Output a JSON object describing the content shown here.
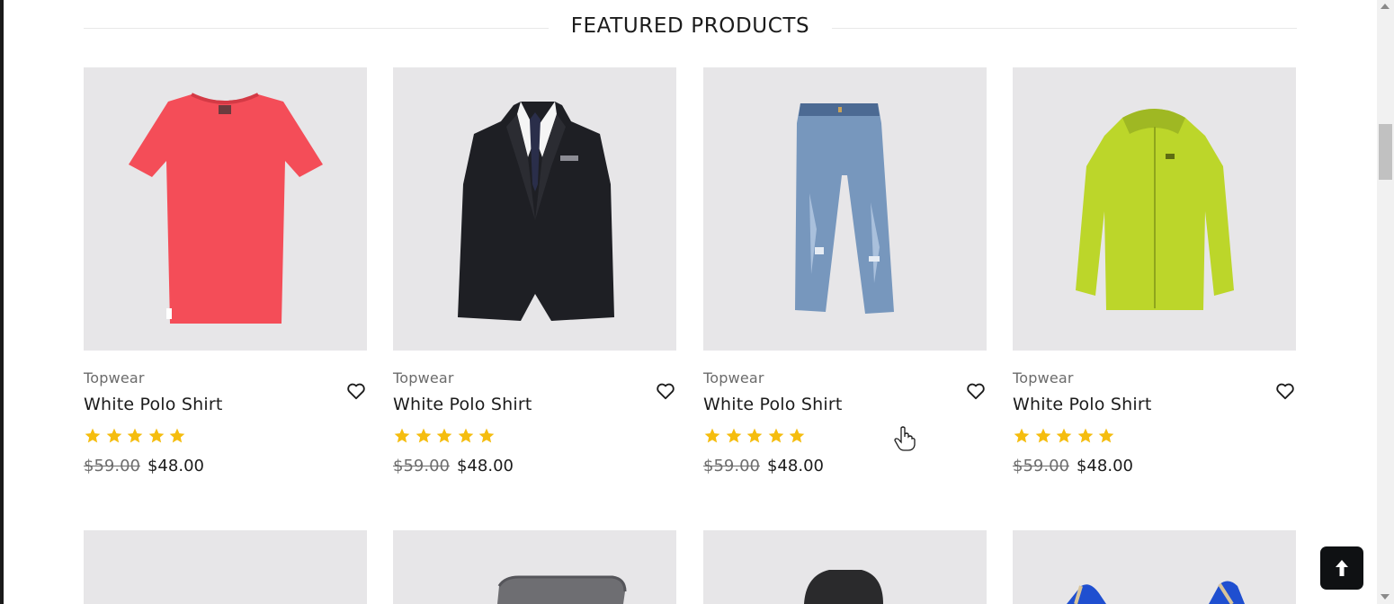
{
  "section": {
    "title": "FEATURED PRODUCTS"
  },
  "products": [
    {
      "category": "Topwear",
      "title": "White Polo Shirt",
      "rating": 5,
      "old_price": "$59.00",
      "new_price": "$48.00",
      "image_icon": "red-tshirt-icon"
    },
    {
      "category": "Topwear",
      "title": "White Polo Shirt",
      "rating": 5,
      "old_price": "$59.00",
      "new_price": "$48.00",
      "image_icon": "black-suit-jacket-icon"
    },
    {
      "category": "Topwear",
      "title": "White Polo Shirt",
      "rating": 5,
      "old_price": "$59.00",
      "new_price": "$48.00",
      "image_icon": "blue-jeans-icon"
    },
    {
      "category": "Topwear",
      "title": "White Polo Shirt",
      "rating": 5,
      "old_price": "$59.00",
      "new_price": "$48.00",
      "image_icon": "lime-rain-jacket-icon"
    }
  ],
  "products_row2": [
    {
      "image_icon": "product-image-placeholder"
    },
    {
      "image_icon": "gray-chair-icon"
    },
    {
      "image_icon": "black-chair-icon"
    },
    {
      "image_icon": "blue-shoes-icon"
    }
  ],
  "colors": {
    "star": "#f5bd0f",
    "image_bg": "#e7e6e8",
    "back_to_top_bg": "#0f1113"
  }
}
